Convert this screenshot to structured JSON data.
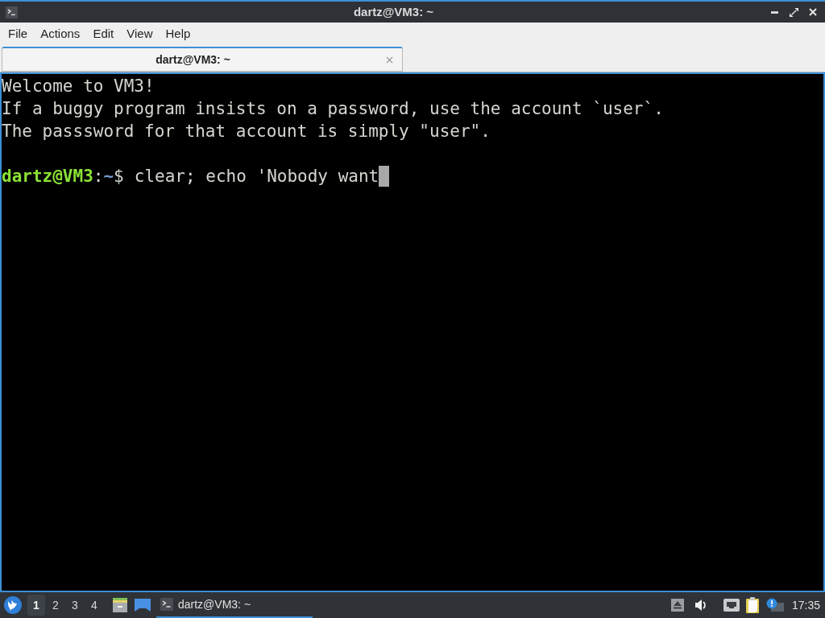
{
  "window": {
    "title": "dartz@VM3: ~"
  },
  "menu": [
    "File",
    "Actions",
    "Edit",
    "View",
    "Help"
  ],
  "tabs": [
    {
      "label": "dartz@VM3: ~",
      "selected": true
    }
  ],
  "terminal": {
    "lines": [
      {
        "kind": "output",
        "text": "Welcome to VM3!"
      },
      {
        "kind": "output",
        "text": "If a buggy program insists on a password, use the account `user`."
      },
      {
        "kind": "output",
        "text": "The passsword for that account is simply \"user\"."
      },
      {
        "kind": "blank"
      },
      {
        "kind": "prompt",
        "user_host": "dartz@VM3",
        "separator": ":",
        "path": "~",
        "symbol": "$",
        "command": "clear; echo 'Nobody want",
        "cursor": true
      }
    ]
  },
  "taskbar": {
    "desktops": [
      {
        "label": "1",
        "selected": true
      },
      {
        "label": "2",
        "selected": false
      },
      {
        "label": "3",
        "selected": false
      },
      {
        "label": "4",
        "selected": false
      }
    ],
    "tasks": [
      {
        "label": "dartz@VM3: ~",
        "selected": true
      }
    ],
    "clock": "17:35"
  }
}
